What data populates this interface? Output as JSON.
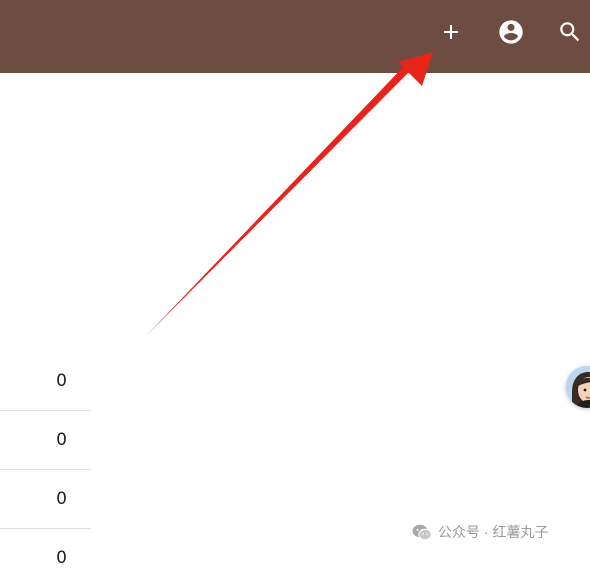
{
  "app_bar": {
    "background_color": "#6d4c41",
    "actions": [
      {
        "name": "add",
        "icon": "plus-icon"
      },
      {
        "name": "account",
        "icon": "account-circle-icon"
      },
      {
        "name": "search",
        "icon": "search-icon"
      }
    ]
  },
  "annotation": {
    "type": "arrow",
    "color": "#e8231a"
  },
  "list": {
    "values": [
      "0",
      "0",
      "0",
      "0"
    ]
  },
  "floating_helper": {
    "icon": "avatar-helper-icon"
  },
  "watermark": {
    "icon": "wechat-icon",
    "text": "公众号 · 红薯丸子"
  }
}
